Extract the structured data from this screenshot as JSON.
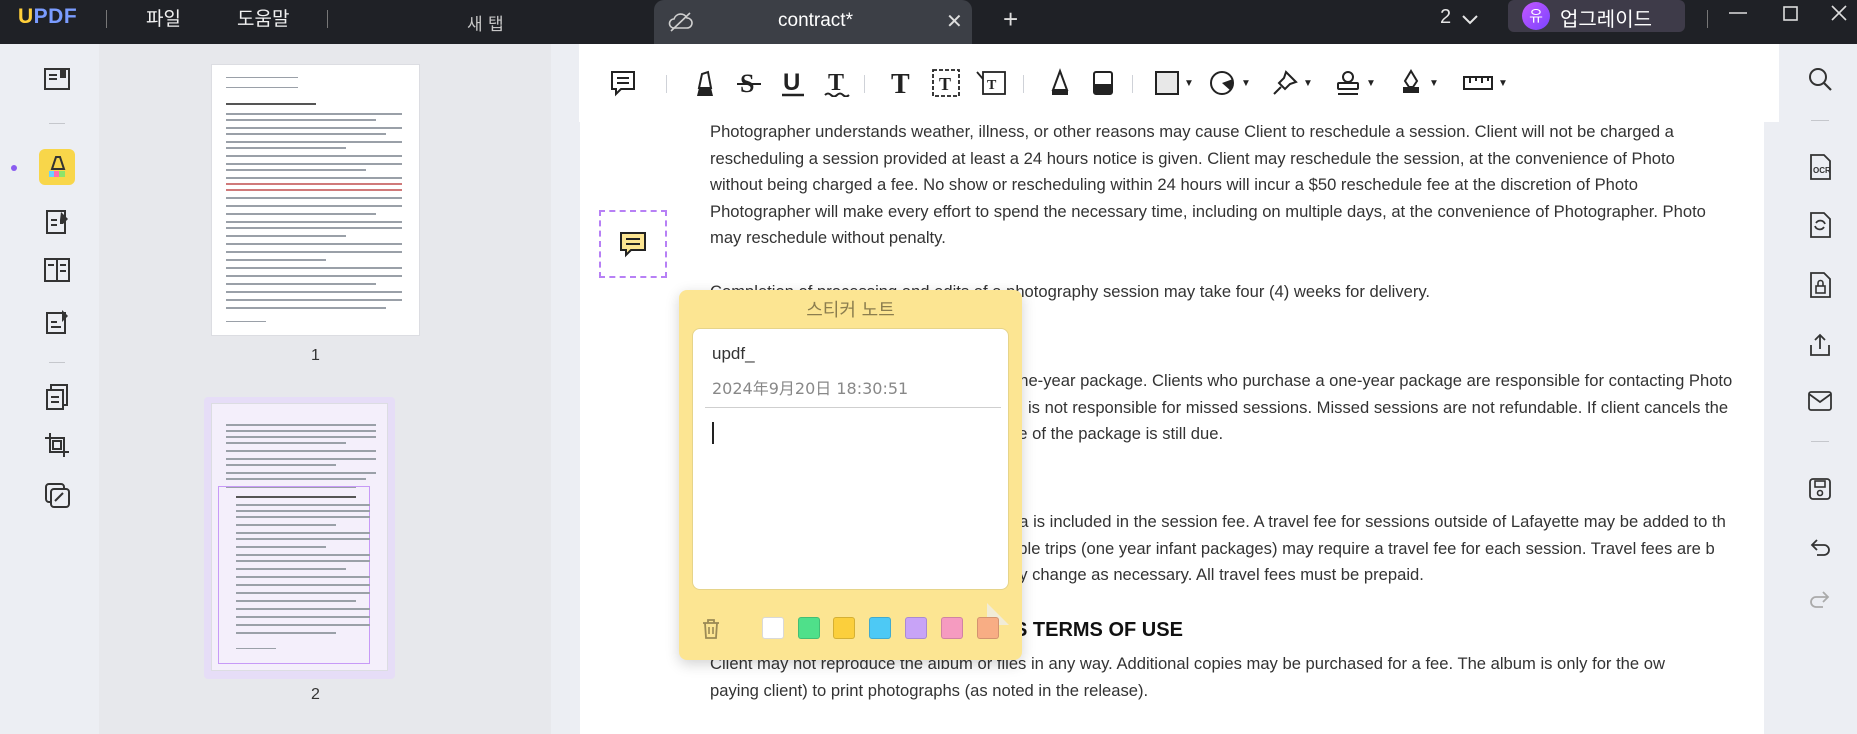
{
  "titlebar": {
    "logo_u": "U",
    "logo_rest": "PDF",
    "menu_file": "파일",
    "menu_help": "도움말",
    "new_tab": "새 탭",
    "active_tab": "contract*",
    "page_count": "2",
    "avatar_letter": "유",
    "upgrade_label": "업그레이드"
  },
  "thumbnails": [
    {
      "label": "1"
    },
    {
      "label": "2"
    }
  ],
  "document": {
    "lines": [
      "Photographer understands weather, illness, or other reasons may cause Client to reschedule a session. Client will not be charged a",
      "rescheduling a session provided at least a 24 hours notice is given. Client may reschedule the session, at the convenience of Photo",
      "without being charged a fee. No show or rescheduling within 24 hours will incur a $50 reschedule fee at the discretion of Photo",
      "Photographer will make every effort to spend the necessary time, including on multiple days, at the convenience of Photographer. Photo",
      "may reschedule without penalty.",
      "Completion of processing and edits of a photography session may take four (4) weeks for delivery.",
      "one-year package. Clients who purchase a one-year package are responsible for contacting Photo",
      "is not responsible for missed sessions. Missed sessions are not refundable. If client cancels the",
      "ce of the package is still due.",
      "ea is included in the session fee. A travel fee for sessions outside of Lafayette may be added to th",
      "tiple trips (one year infant packages) may require a travel fee for each session. Travel fees are b",
      "ay change as necessary. All travel fees must be prepaid.",
      "Client may not reproduce the album or files in any way. Additional copies may be purchased for a fee. The album is only for the ow",
      "paying client) to print photographs (as noted in the release)."
    ],
    "heading_terms": "S TERMS OF USE"
  },
  "sticky_note": {
    "title": "스티커 노트",
    "author": "updf_",
    "date": "2024年9月20日 18:30:51",
    "content": "",
    "colors": [
      "#ffffff",
      "#4fe08a",
      "#fbcf3c",
      "#4dc9f5",
      "#c8a3f7",
      "#f59bc0",
      "#f8ad84"
    ]
  },
  "colors": {
    "accent": "#8a5cf0",
    "sticky_bg": "#fce592",
    "titlebar_bg": "#1f2126"
  }
}
